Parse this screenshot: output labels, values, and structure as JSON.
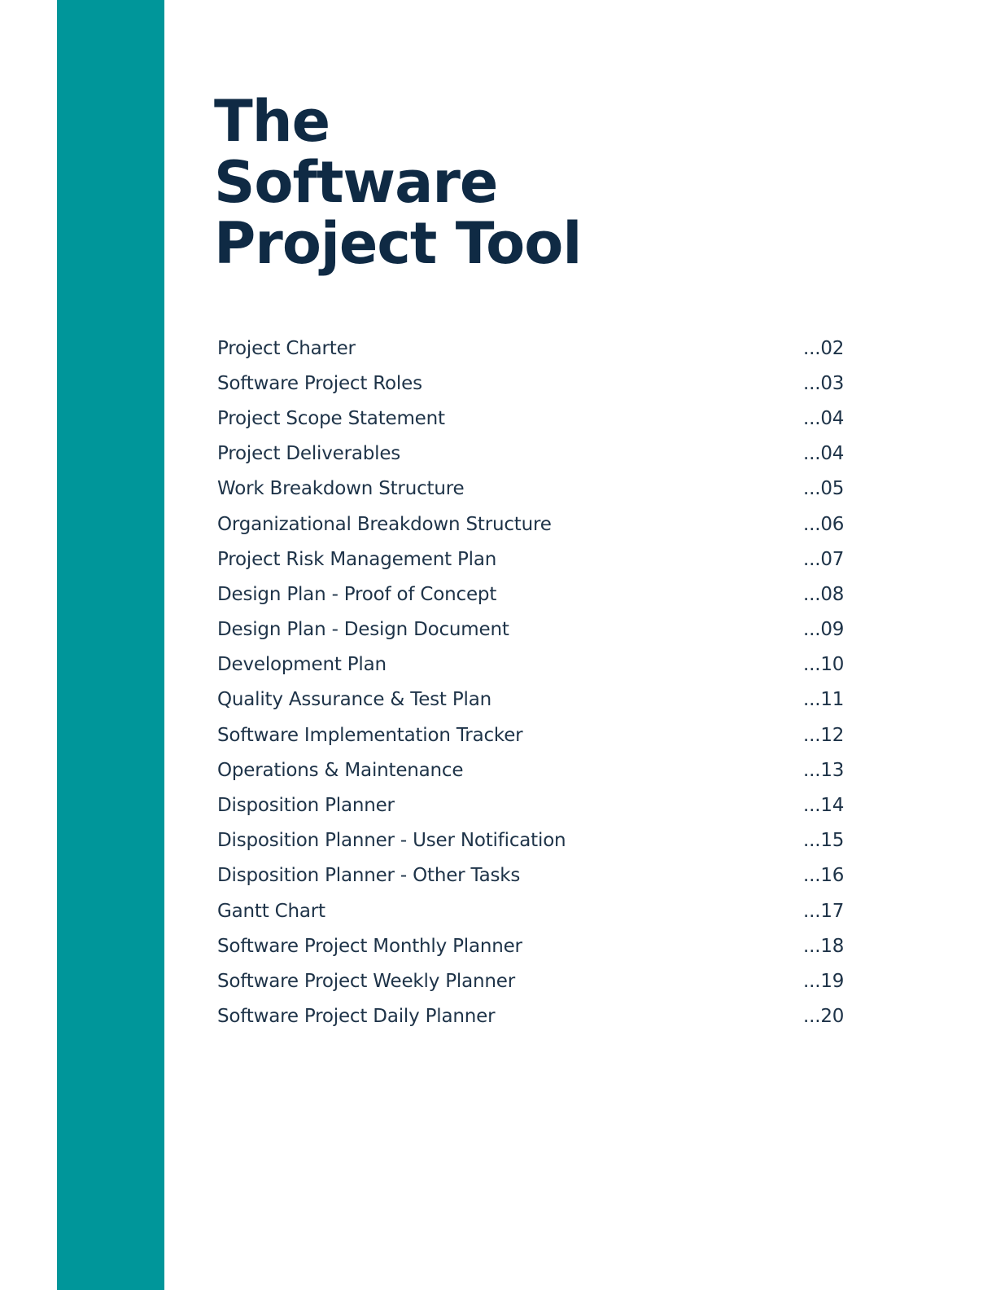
{
  "colors": {
    "accent_bar": "#00969A",
    "title": "#0F2A44",
    "toc_text": "#1E3348"
  },
  "title": {
    "line1": "The",
    "line2": "Software",
    "line3": "Project Tool"
  },
  "toc": [
    {
      "label": "Project Charter",
      "page": "...02"
    },
    {
      "label": "Software Project Roles",
      "page": "...03"
    },
    {
      "label": "Project Scope Statement",
      "page": "...04"
    },
    {
      "label": "Project Deliverables",
      "page": "...04"
    },
    {
      "label": "Work Breakdown Structure",
      "page": "...05"
    },
    {
      "label": "Organizational Breakdown Structure",
      "page": "...06"
    },
    {
      "label": "Project Risk Management Plan",
      "page": "...07"
    },
    {
      "label": "Design Plan - Proof of Concept",
      "page": "...08"
    },
    {
      "label": "Design Plan - Design Document",
      "page": "...09"
    },
    {
      "label": "Development Plan",
      "page": "...10"
    },
    {
      "label": "Quality Assurance & Test Plan",
      "page": "...11"
    },
    {
      "label": "Software Implementation Tracker",
      "page": "...12"
    },
    {
      "label": "Operations & Maintenance",
      "page": "...13"
    },
    {
      "label": "Disposition Planner",
      "page": "...14"
    },
    {
      "label": "Disposition Planner - User Notification",
      "page": "...15"
    },
    {
      "label": "Disposition Planner - Other Tasks",
      "page": "...16"
    },
    {
      "label": "Gantt Chart",
      "page": "...17"
    },
    {
      "label": "Software Project Monthly Planner",
      "page": "...18"
    },
    {
      "label": "Software Project Weekly Planner",
      "page": "...19"
    },
    {
      "label": "Software Project Daily Planner",
      "page": "...20"
    }
  ]
}
